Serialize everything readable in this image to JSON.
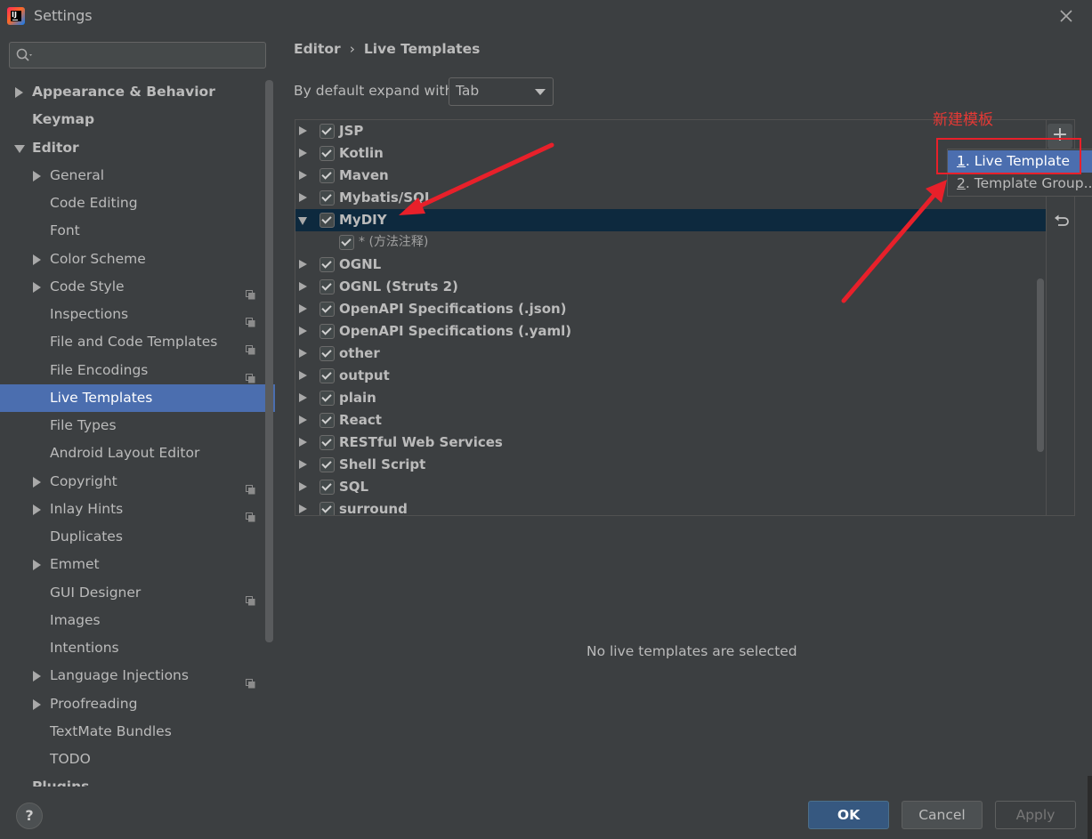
{
  "window": {
    "title": "Settings"
  },
  "sidebar": {
    "search": {
      "value": ""
    },
    "items": [
      {
        "label": "Appearance & Behavior",
        "level": 0,
        "expand": "collapsed",
        "bold": true,
        "project": false,
        "selected": false
      },
      {
        "label": "Keymap",
        "level": 0,
        "expand": "none",
        "bold": true,
        "project": false,
        "selected": false
      },
      {
        "label": "Editor",
        "level": 0,
        "expand": "expanded",
        "bold": true,
        "project": false,
        "selected": false
      },
      {
        "label": "General",
        "level": 1,
        "expand": "collapsed",
        "bold": false,
        "project": false,
        "selected": false
      },
      {
        "label": "Code Editing",
        "level": 1,
        "expand": "none",
        "bold": false,
        "project": false,
        "selected": false
      },
      {
        "label": "Font",
        "level": 1,
        "expand": "none",
        "bold": false,
        "project": false,
        "selected": false
      },
      {
        "label": "Color Scheme",
        "level": 1,
        "expand": "collapsed",
        "bold": false,
        "project": false,
        "selected": false
      },
      {
        "label": "Code Style",
        "level": 1,
        "expand": "collapsed",
        "bold": false,
        "project": true,
        "selected": false
      },
      {
        "label": "Inspections",
        "level": 1,
        "expand": "none",
        "bold": false,
        "project": true,
        "selected": false
      },
      {
        "label": "File and Code Templates",
        "level": 1,
        "expand": "none",
        "bold": false,
        "project": true,
        "selected": false
      },
      {
        "label": "File Encodings",
        "level": 1,
        "expand": "none",
        "bold": false,
        "project": true,
        "selected": false
      },
      {
        "label": "Live Templates",
        "level": 1,
        "expand": "none",
        "bold": false,
        "project": false,
        "selected": true
      },
      {
        "label": "File Types",
        "level": 1,
        "expand": "none",
        "bold": false,
        "project": false,
        "selected": false
      },
      {
        "label": "Android Layout Editor",
        "level": 1,
        "expand": "none",
        "bold": false,
        "project": false,
        "selected": false
      },
      {
        "label": "Copyright",
        "level": 1,
        "expand": "collapsed",
        "bold": false,
        "project": true,
        "selected": false
      },
      {
        "label": "Inlay Hints",
        "level": 1,
        "expand": "collapsed",
        "bold": false,
        "project": true,
        "selected": false
      },
      {
        "label": "Duplicates",
        "level": 1,
        "expand": "none",
        "bold": false,
        "project": false,
        "selected": false
      },
      {
        "label": "Emmet",
        "level": 1,
        "expand": "collapsed",
        "bold": false,
        "project": false,
        "selected": false
      },
      {
        "label": "GUI Designer",
        "level": 1,
        "expand": "none",
        "bold": false,
        "project": true,
        "selected": false
      },
      {
        "label": "Images",
        "level": 1,
        "expand": "none",
        "bold": false,
        "project": false,
        "selected": false
      },
      {
        "label": "Intentions",
        "level": 1,
        "expand": "none",
        "bold": false,
        "project": false,
        "selected": false
      },
      {
        "label": "Language Injections",
        "level": 1,
        "expand": "collapsed",
        "bold": false,
        "project": true,
        "selected": false
      },
      {
        "label": "Proofreading",
        "level": 1,
        "expand": "collapsed",
        "bold": false,
        "project": false,
        "selected": false
      },
      {
        "label": "TextMate Bundles",
        "level": 1,
        "expand": "none",
        "bold": false,
        "project": false,
        "selected": false
      },
      {
        "label": "TODO",
        "level": 1,
        "expand": "none",
        "bold": false,
        "project": false,
        "selected": false
      },
      {
        "label": "Plugins",
        "level": 0,
        "expand": "none",
        "bold": true,
        "project": false,
        "selected": false
      }
    ]
  },
  "breadcrumb": {
    "parent": "Editor",
    "separator": "›",
    "current": "Live Templates"
  },
  "expand": {
    "label": "By default expand with",
    "value": "Tab"
  },
  "templates": {
    "groups": [
      {
        "label": "JSP",
        "checked": true,
        "expanded": false,
        "selected": false,
        "child": false
      },
      {
        "label": "Kotlin",
        "checked": true,
        "expanded": false,
        "selected": false,
        "child": false
      },
      {
        "label": "Maven",
        "checked": true,
        "expanded": false,
        "selected": false,
        "child": false
      },
      {
        "label": "Mybatis/SQL",
        "checked": true,
        "expanded": false,
        "selected": false,
        "child": false
      },
      {
        "label": "MyDIY",
        "checked": true,
        "expanded": true,
        "selected": true,
        "child": false
      },
      {
        "label": "* (方法注释)",
        "checked": true,
        "expanded": false,
        "selected": false,
        "child": true
      },
      {
        "label": "OGNL",
        "checked": true,
        "expanded": false,
        "selected": false,
        "child": false
      },
      {
        "label": "OGNL (Struts 2)",
        "checked": true,
        "expanded": false,
        "selected": false,
        "child": false
      },
      {
        "label": "OpenAPI Specifications (.json)",
        "checked": true,
        "expanded": false,
        "selected": false,
        "child": false
      },
      {
        "label": "OpenAPI Specifications (.yaml)",
        "checked": true,
        "expanded": false,
        "selected": false,
        "child": false
      },
      {
        "label": "other",
        "checked": true,
        "expanded": false,
        "selected": false,
        "child": false
      },
      {
        "label": "output",
        "checked": true,
        "expanded": false,
        "selected": false,
        "child": false
      },
      {
        "label": "plain",
        "checked": true,
        "expanded": false,
        "selected": false,
        "child": false
      },
      {
        "label": "React",
        "checked": true,
        "expanded": false,
        "selected": false,
        "child": false
      },
      {
        "label": "RESTful Web Services",
        "checked": true,
        "expanded": false,
        "selected": false,
        "child": false
      },
      {
        "label": "Shell Script",
        "checked": true,
        "expanded": false,
        "selected": false,
        "child": false
      },
      {
        "label": "SQL",
        "checked": true,
        "expanded": false,
        "selected": false,
        "child": false
      },
      {
        "label": "surround",
        "checked": true,
        "expanded": false,
        "selected": false,
        "child": false
      }
    ],
    "add_symbol": "+",
    "empty_message": "No live templates are selected"
  },
  "popup_menu": {
    "items": [
      {
        "mnemonic": "1",
        "rest": ". Live Template",
        "active": true
      },
      {
        "mnemonic": "2",
        "rest": ". Template Group...",
        "active": false
      }
    ]
  },
  "annotation": {
    "label": "新建模板",
    "color": "#e8202a"
  },
  "footer": {
    "help": "?",
    "ok": "OK",
    "cancel": "Cancel",
    "apply": "Apply"
  },
  "colors": {
    "selection": "#4b6eaf",
    "selected_group": "#0d293e",
    "ok_button": "#365880",
    "background": "#3c3f41"
  }
}
